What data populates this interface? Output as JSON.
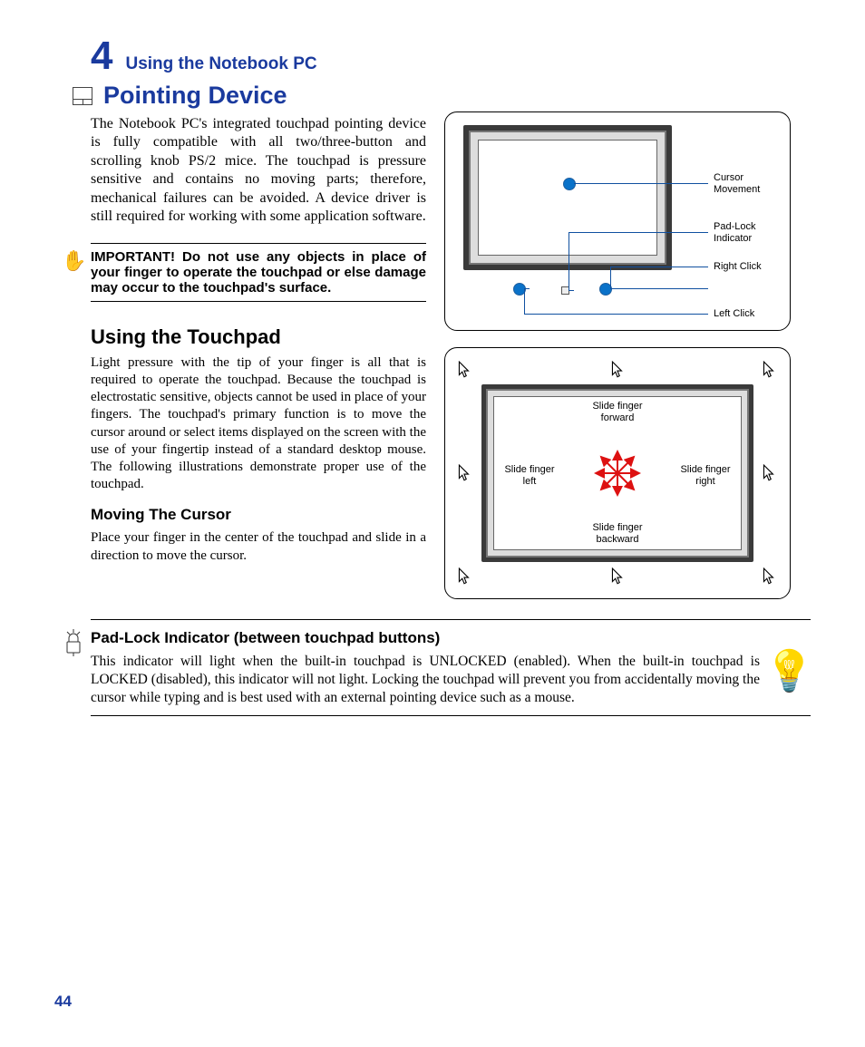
{
  "chapter": {
    "number": "4",
    "title": "Using the Notebook PC"
  },
  "section1": {
    "title": "Pointing Device",
    "para": "The Notebook PC's integrated touchpad pointing device is fully compatible with all two/three-button and scrolling knob PS/2 mice. The touchpad is pressure sensitive and contains no moving parts; therefore, mechanical failures can be avoided. A device driver is still required for working with some application software.",
    "callout": "IMPORTANT! Do not use any objects in place of your finger to operate the touchpad or else damage may occur to the touchpad's surface."
  },
  "section2": {
    "title": "Using the Touchpad",
    "para": "Light pressure with the tip of your finger is all that is required to operate the touchpad. Because the touchpad is electrostatic sensitive, objects cannot be used in place of your fingers. The touchpad's primary function is to move the cursor around or select items displayed on the screen with the use of your fingertip instead of a standard desktop mouse. The following illustrations demonstrate proper use of the touchpad."
  },
  "section3": {
    "title": "Moving The Cursor",
    "para": "Place your finger in the center of the touchpad and slide in a direction to move the cursor."
  },
  "fig1": {
    "labels": {
      "cursor_movement": "Cursor\nMovement",
      "padlock_indicator": "Pad-Lock\nIndicator",
      "right_click": "Right Click",
      "left_click": "Left Click"
    }
  },
  "fig2": {
    "slide_forward": "Slide finger\nforward",
    "slide_left": "Slide finger\nleft",
    "slide_right": "Slide finger\nright",
    "slide_backward": "Slide finger\nbackward"
  },
  "section4": {
    "title": "Pad-Lock Indicator (between touchpad buttons)",
    "para": "This indicator will light when the built-in touchpad is UNLOCKED (enabled). When the built-in touchpad is LOCKED (disabled), this indicator will not light. Locking the touchpad will prevent you from accidentally moving the cursor while typing and is best used with an external pointing device such as a mouse."
  },
  "page_number": "44"
}
